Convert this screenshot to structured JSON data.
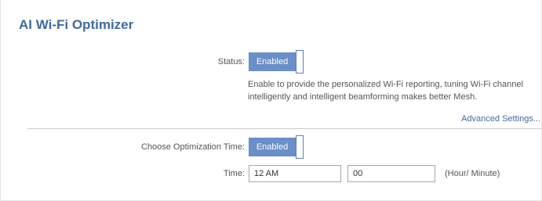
{
  "section": {
    "title": "AI Wi-Fi Optimizer"
  },
  "status": {
    "label": "Status:",
    "toggle_label": "Enabled",
    "description": "Enable to provide the personalized Wi-Fi reporting, tuning Wi-Fi channel intelligently and intelligent beamforming makes better Mesh."
  },
  "advanced_link": "Advanced Settings...",
  "optimization": {
    "label": "Choose Optimization Time:",
    "toggle_label": "Enabled"
  },
  "time": {
    "label": "Time:",
    "hour_value": "12 AM",
    "minute_value": "00",
    "unit": "(Hour/ Minute)"
  },
  "colors": {
    "accent": "#3f6a9f",
    "toggle_on": "#6b8fc7"
  }
}
